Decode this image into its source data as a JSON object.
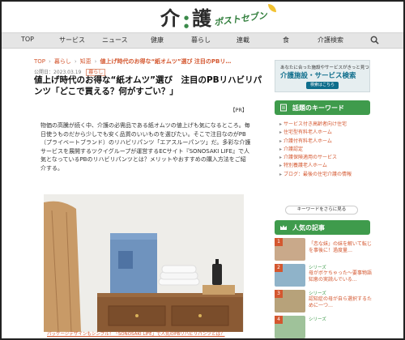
{
  "header": {
    "logo_kanji_1": "介",
    "logo_kanji_2": "護",
    "logo_post": "ポストセブン"
  },
  "nav": {
    "items": [
      "TOP",
      "サービス",
      "ニュース",
      "健康",
      "暮らし",
      "連載",
      "食",
      "介護検索"
    ]
  },
  "breadcrumb": {
    "items": [
      "TOP",
      "暮らし",
      "知恵"
    ],
    "current": "値上げ時代のお得な“紙オムツ”選び 注目のPBリ…"
  },
  "meta": {
    "date": "公開日：2023.03.19",
    "category": "暮らし"
  },
  "article": {
    "title": "値上げ時代のお得な“紙オムツ”選び　注目のPBリハビリパンツ「どこで買える？何がすごい？」",
    "pr": "【PR】",
    "body": "物価の高騰が続く中、介護の必需品である紙オムツの値上げも気になるところ。毎日使うものだから少しでも安く品質のいいものを選びたい。そこで注目なのがPB（プライベートブランド）のリハビリパンツ「エアスルーパンツ」だ。多彩な介護サービスを展開するツクイグループが運営するECサイト『SONOSAKI LIFE』で人気となっているPBのリハビリパンツとは？メリットやおすすめの購入方法をご紹介する。",
    "caption": "パッケージデザインもシンプル！「SONOSAKI LIFE」で人気のPBリハビリパンツとは？"
  },
  "sidebar": {
    "ad": {
      "top": "あなたに合った施設やサービスがきっと見つかる",
      "main": "介護施設・サービス検索",
      "button": "検索はこちら"
    },
    "keywords_title": "話題のキーワード",
    "keywords": [
      "サービス付き高齢者向け住宅",
      "住宅型有料老人ホーム",
      "介護付有料老人ホーム",
      "介護認定",
      "介護保険適用のサービス",
      "特別養護老人ホーム",
      "ブログ：最後の住宅介護の情報"
    ],
    "keywords_more": "キーワードをさらに見る",
    "ranking_title": "人気の記事",
    "ranking": [
      {
        "num": "1",
        "series": "",
        "title": "「恋な妹」の妹を解いて転じを事後に！過度量…"
      },
      {
        "num": "2",
        "series": "シリーズ",
        "title": "母がボケちゃった～要事物語 知恵の実読んでいる…"
      },
      {
        "num": "3",
        "series": "シリーズ",
        "title": "認知症の母が自ら選択するために一つ…"
      },
      {
        "num": "4",
        "series": "シリーズ",
        "title": ""
      }
    ]
  },
  "colors": {
    "accent": "#d4572f",
    "green": "#3f9b4c",
    "nav_bg": "#e5e5e5"
  }
}
